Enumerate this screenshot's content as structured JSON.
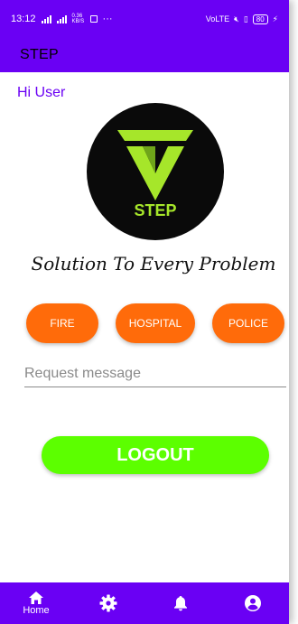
{
  "status": {
    "time": "13:12",
    "battery": "80",
    "speed": "0.36 KB/S"
  },
  "appbar": {
    "title": "STEP"
  },
  "greeting": "Hi  User",
  "logo": {
    "text": "STEP",
    "colors": {
      "bg": "#0a0a0a",
      "accent": "#a6e62a"
    }
  },
  "tagline": "Solution To Every Problem",
  "buttons": {
    "fire": "FIRE",
    "hospital": "HOSPITAL",
    "police": "POLICE"
  },
  "request": {
    "placeholder": "Request message",
    "value": ""
  },
  "logout": "LOGOUT",
  "nav": {
    "home": "Home",
    "items": [
      "home-icon",
      "gear-icon",
      "bell-icon",
      "account-icon"
    ]
  },
  "colors": {
    "primary": "#6a00f4",
    "orange": "#ff6b0a",
    "green": "#5cff00"
  }
}
